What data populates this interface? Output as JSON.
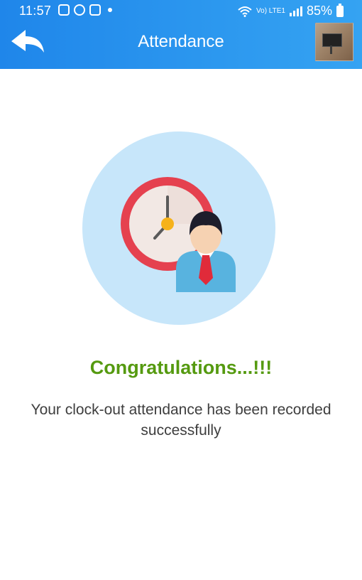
{
  "status_bar": {
    "time": "11:57",
    "network_label": "Vo) LTE1",
    "battery": "85%"
  },
  "header": {
    "title": "Attendance"
  },
  "main": {
    "heading": "Congratulations...!!!",
    "message": "Your clock-out attendance has been recorded successfully"
  },
  "colors": {
    "header_blue": "#2a95ee",
    "heading_green": "#559a10",
    "illustration_bg": "#c7e6fa",
    "clock_red": "#e5414f",
    "tie_red": "#e02b3a",
    "shirt_blue": "#58b3df"
  },
  "icons": {
    "back": "back-arrow-icon",
    "illustration": "clock-employee-icon"
  }
}
